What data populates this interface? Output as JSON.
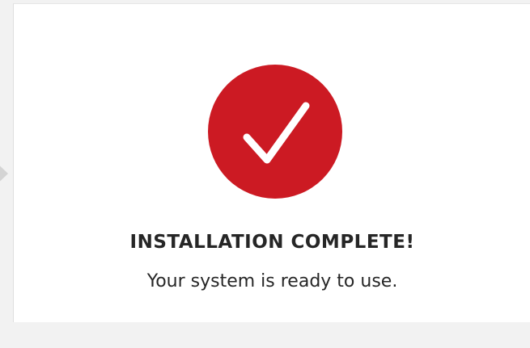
{
  "status": {
    "icon": "checkmark-icon",
    "accent_color": "#cc1a23",
    "title": "INSTALLATION COMPLETE!",
    "message": "Your system is ready to use."
  }
}
